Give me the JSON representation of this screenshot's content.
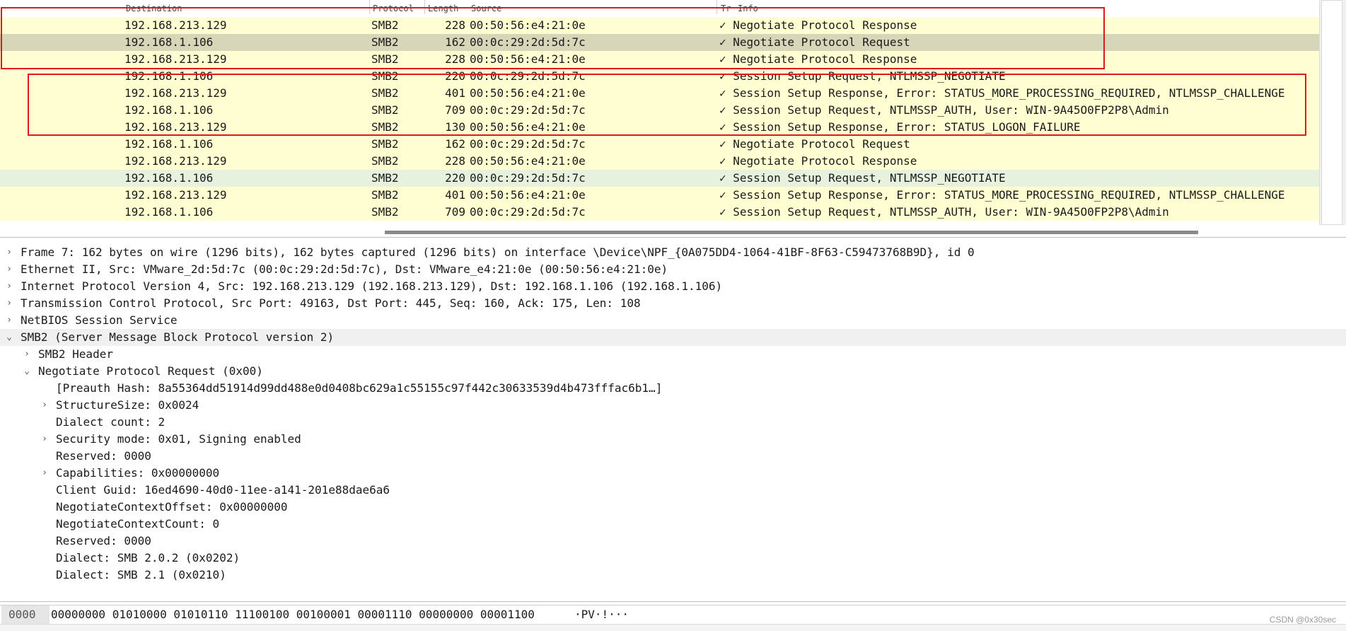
{
  "packet_list": {
    "headers": {
      "destination": "Destination",
      "protocol": "Protocol",
      "length": "Length",
      "source": "Source",
      "tr": "Tr",
      "info": "Info"
    },
    "rows": [
      {
        "destination": "192.168.213.129",
        "protocol": "SMB2",
        "length": "228",
        "source": "00:50:56:e4:21:0e",
        "info": "✓ Negotiate Protocol Response",
        "bg": "#ffffd2"
      },
      {
        "destination": "192.168.1.106",
        "protocol": "SMB2",
        "length": "162",
        "source": "00:0c:29:2d:5d:7c",
        "info": "✓ Negotiate Protocol Request",
        "bg": "#d8d6b8"
      },
      {
        "destination": "192.168.213.129",
        "protocol": "SMB2",
        "length": "228",
        "source": "00:50:56:e4:21:0e",
        "info": "✓ Negotiate Protocol Response",
        "bg": "#ffffd2"
      },
      {
        "destination": "192.168.1.106",
        "protocol": "SMB2",
        "length": "220",
        "source": "00:0c:29:2d:5d:7c",
        "info": "✓ Session Setup Request, NTLMSSP_NEGOTIATE",
        "bg": "#ffffd2"
      },
      {
        "destination": "192.168.213.129",
        "protocol": "SMB2",
        "length": "401",
        "source": "00:50:56:e4:21:0e",
        "info": "✓ Session Setup Response, Error: STATUS_MORE_PROCESSING_REQUIRED, NTLMSSP_CHALLENGE",
        "bg": "#ffffd2"
      },
      {
        "destination": "192.168.1.106",
        "protocol": "SMB2",
        "length": "709",
        "source": "00:0c:29:2d:5d:7c",
        "info": "✓ Session Setup Request, NTLMSSP_AUTH, User: WIN-9A45O0FP2P8\\Admin",
        "bg": "#ffffd2"
      },
      {
        "destination": "192.168.213.129",
        "protocol": "SMB2",
        "length": "130",
        "source": "00:50:56:e4:21:0e",
        "info": "✓ Session Setup Response, Error: STATUS_LOGON_FAILURE",
        "bg": "#ffffd2"
      },
      {
        "destination": "192.168.1.106",
        "protocol": "SMB2",
        "length": "162",
        "source": "00:0c:29:2d:5d:7c",
        "info": "✓ Negotiate Protocol Request",
        "bg": "#ffffd2"
      },
      {
        "destination": "192.168.213.129",
        "protocol": "SMB2",
        "length": "228",
        "source": "00:50:56:e4:21:0e",
        "info": "✓ Negotiate Protocol Response",
        "bg": "#ffffd2"
      },
      {
        "destination": "192.168.1.106",
        "protocol": "SMB2",
        "length": "220",
        "source": "00:0c:29:2d:5d:7c",
        "info": "✓ Session Setup Request, NTLMSSP_NEGOTIATE",
        "bg": "#e6f2dd"
      },
      {
        "destination": "192.168.213.129",
        "protocol": "SMB2",
        "length": "401",
        "source": "00:50:56:e4:21:0e",
        "info": "✓ Session Setup Response, Error: STATUS_MORE_PROCESSING_REQUIRED, NTLMSSP_CHALLENGE",
        "bg": "#ffffd2"
      },
      {
        "destination": "192.168.1.106",
        "protocol": "SMB2",
        "length": "709",
        "source": "00:0c:29:2d:5d:7c",
        "info": "✓ Session Setup Request, NTLMSSP_AUTH, User: WIN-9A45O0FP2P8\\Admin",
        "bg": "#ffffd2"
      }
    ]
  },
  "details": {
    "rows": [
      {
        "text": "Frame 7: 162 bytes on wire (1296 bits), 162 bytes captured (1296 bits) on interface \\Device\\NPF_{0A075DD4-1064-41BF-8F63-C59473768B9D}, id 0",
        "arrow": "›",
        "level": 0
      },
      {
        "text": "Ethernet II, Src: VMware_2d:5d:7c (00:0c:29:2d:5d:7c), Dst: VMware_e4:21:0e (00:50:56:e4:21:0e)",
        "arrow": "›",
        "level": 0
      },
      {
        "text": "Internet Protocol Version 4, Src: 192.168.213.129 (192.168.213.129), Dst: 192.168.1.106 (192.168.1.106)",
        "arrow": "›",
        "level": 0
      },
      {
        "text": "Transmission Control Protocol, Src Port: 49163, Dst Port: 445, Seq: 160, Ack: 175, Len: 108",
        "arrow": "›",
        "level": 0
      },
      {
        "text": "NetBIOS Session Service",
        "arrow": "›",
        "level": 0
      },
      {
        "text": "SMB2 (Server Message Block Protocol version 2)",
        "arrow": "⌄",
        "level": 0,
        "selected": true
      },
      {
        "text": "SMB2 Header",
        "arrow": "›",
        "level": 1
      },
      {
        "text": "Negotiate Protocol Request (0x00)",
        "arrow": "⌄",
        "level": 1
      },
      {
        "text": "[Preauth Hash: 8a55364dd51914d99dd488e0d0408bc629a1c55155c97f442c30633539d4b473fffac6b1…]",
        "arrow": "",
        "level": 2
      },
      {
        "text": "StructureSize: 0x0024",
        "arrow": "›",
        "level": 2
      },
      {
        "text": "Dialect count: 2",
        "arrow": "",
        "level": 2
      },
      {
        "text": "Security mode: 0x01, Signing enabled",
        "arrow": "›",
        "level": 2
      },
      {
        "text": "Reserved: 0000",
        "arrow": "",
        "level": 2
      },
      {
        "text": "Capabilities: 0x00000000",
        "arrow": "›",
        "level": 2
      },
      {
        "text": "Client Guid: 16ed4690-40d0-11ee-a141-201e88dae6a6",
        "arrow": "",
        "level": 2
      },
      {
        "text": "NegotiateContextOffset: 0x00000000",
        "arrow": "",
        "level": 2
      },
      {
        "text": "NegotiateContextCount: 0",
        "arrow": "",
        "level": 2
      },
      {
        "text": "Reserved: 0000",
        "arrow": "",
        "level": 2
      },
      {
        "text": "Dialect: SMB 2.0.2 (0x0202)",
        "arrow": "",
        "level": 2
      },
      {
        "text": "Dialect: SMB 2.1 (0x0210)",
        "arrow": "",
        "level": 2
      }
    ]
  },
  "bytes": {
    "offset": "0000",
    "bits": "00000000 01010000 01010110 11100100 00100001 00001110 00000000 00001100",
    "ascii": "·PV·!···"
  },
  "watermark": "CSDN @0x30sec",
  "colors": {
    "highlight_box": "#e01818",
    "smb_row": "#ffffd2",
    "selected_packet": "#d8d6b8"
  }
}
